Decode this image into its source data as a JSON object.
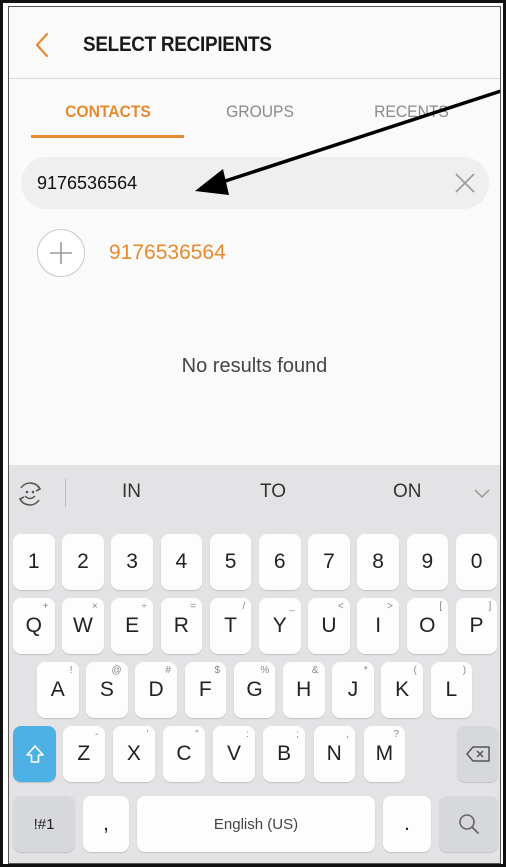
{
  "header": {
    "title": "SELECT RECIPIENTS",
    "back_icon": "chevron-left-icon"
  },
  "tabs": [
    {
      "label": "CONTACTS",
      "active": true
    },
    {
      "label": "GROUPS",
      "active": false
    },
    {
      "label": "RECENTS",
      "active": false
    }
  ],
  "search": {
    "value": "9176536564",
    "clear_icon": "close-icon"
  },
  "result": {
    "number": "9176536564",
    "add_icon": "plus-icon"
  },
  "empty_message": "No results found",
  "keyboard": {
    "suggestions": [
      "IN",
      "TO",
      "ON"
    ],
    "row_numbers": [
      "1",
      "2",
      "3",
      "4",
      "5",
      "6",
      "7",
      "8",
      "9",
      "0"
    ],
    "row_top": [
      {
        "k": "Q",
        "h": "+"
      },
      {
        "k": "W",
        "h": "×"
      },
      {
        "k": "E",
        "h": "÷"
      },
      {
        "k": "R",
        "h": "="
      },
      {
        "k": "T",
        "h": "/"
      },
      {
        "k": "Y",
        "h": "_"
      },
      {
        "k": "U",
        "h": "<"
      },
      {
        "k": "I",
        "h": ">"
      },
      {
        "k": "O",
        "h": "["
      },
      {
        "k": "P",
        "h": "]"
      }
    ],
    "row_mid": [
      {
        "k": "A",
        "h": "!"
      },
      {
        "k": "S",
        "h": "@"
      },
      {
        "k": "D",
        "h": "#"
      },
      {
        "k": "F",
        "h": "$"
      },
      {
        "k": "G",
        "h": "%"
      },
      {
        "k": "H",
        "h": "&"
      },
      {
        "k": "J",
        "h": "*"
      },
      {
        "k": "K",
        "h": "("
      },
      {
        "k": "L",
        "h": ")"
      }
    ],
    "row_bottom": [
      {
        "k": "Z",
        "h": "-"
      },
      {
        "k": "X",
        "h": "'"
      },
      {
        "k": "C",
        "h": "\""
      },
      {
        "k": "V",
        "h": ":"
      },
      {
        "k": "B",
        "h": ";"
      },
      {
        "k": "N",
        "h": ","
      },
      {
        "k": "M",
        "h": "?"
      }
    ],
    "symbols_key": "!#1",
    "comma_key": ",",
    "space_key": "English (US)",
    "period_key": ".",
    "colors": {
      "accent": "#e68a2e",
      "shift": "#4eb1e6"
    }
  }
}
